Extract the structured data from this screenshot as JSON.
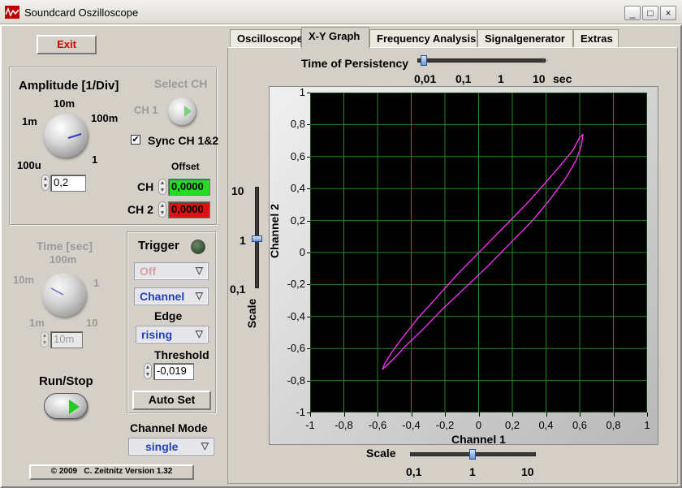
{
  "window": {
    "title": "Soundcard Oszilloscope",
    "buttons": [
      "_",
      "□",
      "×"
    ]
  },
  "exit_label": "Exit",
  "amplitude": {
    "title": "Amplitude [1/Div]",
    "knob_labels": [
      "100u",
      "1m",
      "10m",
      "100m",
      "1"
    ],
    "value": "0,2"
  },
  "select_ch": {
    "title": "Select CH",
    "ch1_label": "CH 1"
  },
  "sync": {
    "label": "Sync CH 1&2",
    "checked": true
  },
  "offset": {
    "title": "Offset",
    "ch1_label": "CH",
    "ch1_value": "0,0000",
    "ch2_label": "CH 2",
    "ch2_value": "0,0000"
  },
  "time": {
    "title": "Time [sec]",
    "knob_labels": [
      "1m",
      "10m",
      "100m",
      "1",
      "10"
    ],
    "value": "10m"
  },
  "trigger": {
    "title": "Trigger",
    "mode": "Off",
    "source": "Channel",
    "edge_label": "Edge",
    "edge": "rising",
    "threshold_label": "Threshold",
    "threshold": "-0,019",
    "autoset_label": "Auto Set"
  },
  "run_stop_label": "Run/Stop",
  "channel_mode": {
    "label": "Channel Mode",
    "value": "single"
  },
  "footer": "© 2009   C. Zeitnitz Version 1.32",
  "tabs": [
    "Oscilloscope",
    "X-Y Graph",
    "Frequency Analysis",
    "Signalgenerator",
    "Extras"
  ],
  "active_tab": 1,
  "persistence": {
    "label": "Time of Persistency",
    "ticks": [
      "0,01",
      "0,1",
      "1",
      "10"
    ],
    "unit": "sec",
    "value": 0.01
  },
  "y_scale": {
    "label": "Scale",
    "ticks": [
      "10",
      "1",
      "0,1"
    ],
    "value": 1
  },
  "x_scale": {
    "label": "Scale",
    "ticks": [
      "0,1",
      "1",
      "10"
    ],
    "value": 1
  },
  "colors": {
    "trace": "#ff33ff",
    "grid": "#1f8a1f",
    "plot_bg": "#000000",
    "ch1_offset": "#22dd22",
    "ch2_offset": "#dd1111"
  },
  "chart_data": {
    "type": "line",
    "xlabel": "Channel 1",
    "ylabel": "Channel 2",
    "xlim": [
      -1,
      1
    ],
    "ylim": [
      -1,
      1
    ],
    "x_ticks": [
      "-1",
      "-0,8",
      "-0,6",
      "-0,4",
      "-0,2",
      "0",
      "0,2",
      "0,4",
      "0,6",
      "0,8",
      "1"
    ],
    "y_ticks": [
      "1",
      "0,8",
      "0,6",
      "0,4",
      "0,2",
      "0",
      "-0,2",
      "-0,4",
      "-0,6",
      "-0,8",
      "-1"
    ],
    "grid": true,
    "series": [
      {
        "shape": "ellipse",
        "x": [
          0.62,
          0.61,
          0.58,
          0.52,
          0.43,
          0.32,
          0.19,
          0.05,
          -0.09,
          -0.22,
          -0.33,
          -0.43,
          -0.5,
          -0.55,
          -0.57,
          -0.56,
          -0.52,
          -0.45,
          -0.36,
          -0.24,
          -0.12,
          0.02,
          0.16,
          0.29,
          0.4,
          0.49,
          0.56,
          0.6,
          0.62
        ],
        "y": [
          0.74,
          0.67,
          0.58,
          0.47,
          0.34,
          0.2,
          0.06,
          -0.09,
          -0.23,
          -0.36,
          -0.48,
          -0.58,
          -0.66,
          -0.71,
          -0.73,
          -0.7,
          -0.63,
          -0.53,
          -0.41,
          -0.27,
          -0.13,
          0.02,
          0.17,
          0.31,
          0.44,
          0.55,
          0.64,
          0.72,
          0.74
        ]
      }
    ]
  }
}
